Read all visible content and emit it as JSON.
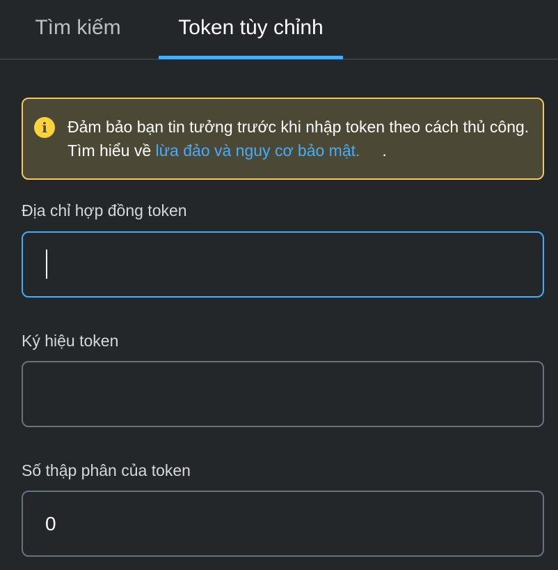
{
  "tabs": {
    "search_label": "Tìm kiếm",
    "custom_label": "Token tùy chỉnh",
    "active": "custom",
    "accent_color": "#43aefc"
  },
  "warning": {
    "icon": "info-icon",
    "text_before": "Đảm bảo bạn tin tưởng trước khi nhập token theo cách thủ công. Tìm hiểu về ",
    "link_text": "lừa đảo và nguy cơ bảo mật.",
    "text_after": "     .",
    "border_color": "#f4ca5d",
    "background_color": "#4c4836"
  },
  "fields": {
    "address": {
      "label": "Địa chỉ hợp đồng token",
      "value": ""
    },
    "symbol": {
      "label": "Ký hiệu token",
      "value": ""
    },
    "decimals": {
      "label": "Số thập phân của token",
      "value": "0"
    }
  }
}
